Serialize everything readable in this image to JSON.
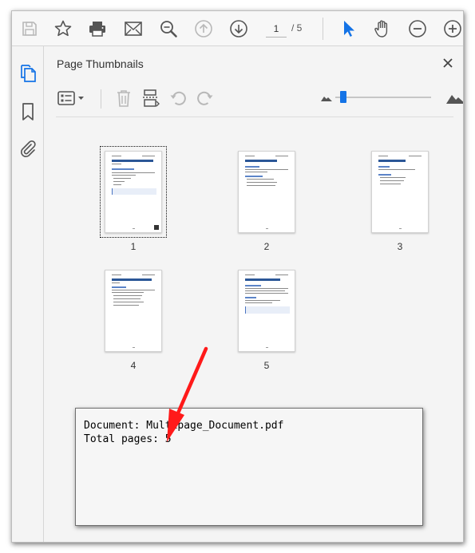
{
  "toolbar": {
    "buttons": [
      {
        "name": "save-icon",
        "enabled": false
      },
      {
        "name": "bookmark-star-icon",
        "enabled": true
      },
      {
        "name": "print-icon",
        "enabled": true
      },
      {
        "name": "email-icon",
        "enabled": true
      },
      {
        "name": "search-icon",
        "enabled": true
      },
      {
        "name": "previous-page-icon",
        "enabled": false
      },
      {
        "name": "next-page-icon",
        "enabled": true
      },
      {
        "name": "select-cursor-icon",
        "enabled": true
      },
      {
        "name": "hand-tool-icon",
        "enabled": true
      },
      {
        "name": "zoom-out-icon",
        "enabled": true
      },
      {
        "name": "zoom-in-icon",
        "enabled": true
      }
    ],
    "current_page": "1",
    "page_total": "/ 5",
    "accent_color": "#1473e6"
  },
  "rail": {
    "items": [
      "page-thumbnails-icon",
      "bookmarks-icon",
      "attachments-icon"
    ],
    "active": "page-thumbnails-icon"
  },
  "panel": {
    "title": "Page Thumbnails",
    "tools": [
      "thumbnail-options-icon",
      "delete-page-icon",
      "insert-page-icon",
      "rotate-counterclockwise-icon",
      "rotate-clockwise-icon"
    ],
    "thumbnail_size_level": 0.05
  },
  "thumbnails": [
    {
      "label": "1",
      "selected": true
    },
    {
      "label": "2",
      "selected": false
    },
    {
      "label": "3",
      "selected": false
    },
    {
      "label": "4",
      "selected": false
    },
    {
      "label": "5",
      "selected": false
    }
  ],
  "console": {
    "line1": "Document: Multipage_Document.pdf",
    "line2": "Total pages: 5"
  },
  "annotation": {
    "arrow_color": "#ff1a1a"
  }
}
